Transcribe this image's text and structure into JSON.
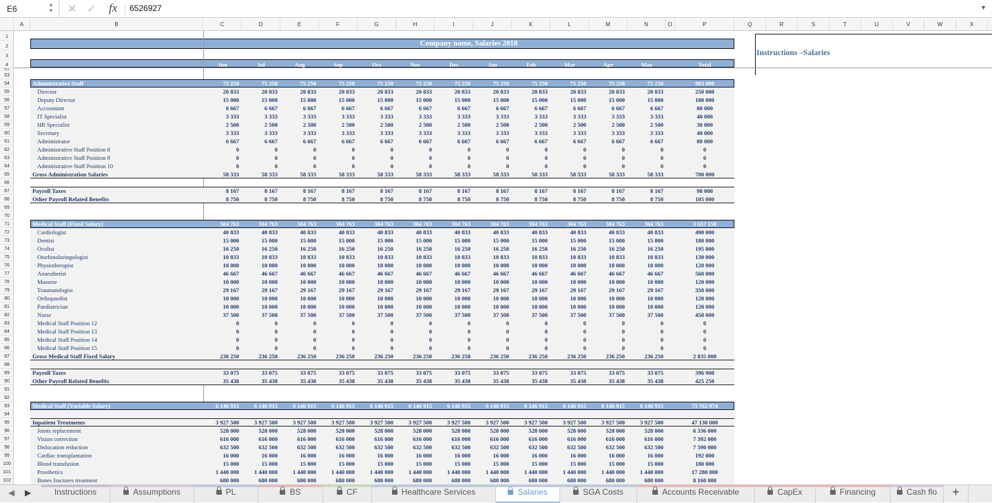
{
  "formula_bar": {
    "cell_ref": "E6",
    "fx_label": "fx",
    "value": "6526927"
  },
  "columns": [
    "A",
    "B",
    "C",
    "D",
    "E",
    "F",
    "G",
    "H",
    "I",
    "J",
    "K",
    "L",
    "M",
    "N",
    "O",
    "P",
    "Q",
    "R",
    "S",
    "T",
    "U",
    "V",
    "W",
    "X"
  ],
  "header": {
    "title": "Company name, Salaries 2018",
    "months": [
      "Jun",
      "Jul",
      "Aug",
      "Sep",
      "Oct",
      "Nov",
      "Dec",
      "Jan",
      "Feb",
      "Mar",
      "Apr",
      "May"
    ],
    "total_label": "Total",
    "instructions_title": "Instructions –Salaries"
  },
  "rows": [
    {
      "n": "52",
      "kind": "blank"
    },
    {
      "n": "53",
      "kind": "blank"
    },
    {
      "n": "54",
      "kind": "section",
      "label": "Administrative Staff",
      "monthly": "75 250",
      "total": "903 000"
    },
    {
      "n": "55",
      "kind": "item",
      "label": "Director",
      "monthly": "20 833",
      "total": "250 000"
    },
    {
      "n": "56",
      "kind": "item",
      "label": "Deputy Director",
      "monthly": "15 000",
      "total": "180 000"
    },
    {
      "n": "57",
      "kind": "item",
      "label": "Accountant",
      "monthly": "6 667",
      "total": "80 000"
    },
    {
      "n": "58",
      "kind": "item",
      "label": "IT Specialist",
      "monthly": "3 333",
      "total": "40 000"
    },
    {
      "n": "59",
      "kind": "item",
      "label": "HR Specialist",
      "monthly": "2 500",
      "total": "30 000"
    },
    {
      "n": "60",
      "kind": "item",
      "label": "Secretary",
      "monthly": "3 333",
      "total": "40 000"
    },
    {
      "n": "61",
      "kind": "item",
      "label": "Administrator",
      "monthly": "6 667",
      "total": "80 000"
    },
    {
      "n": "62",
      "kind": "item",
      "label": "Administrative Staff Position 8",
      "monthly": "0",
      "total": "0"
    },
    {
      "n": "63",
      "kind": "item",
      "label": "Administrative Staff Position 9",
      "monthly": "0",
      "total": "0"
    },
    {
      "n": "64",
      "kind": "item",
      "label": "Administrative Staff Position 10",
      "monthly": "0",
      "total": "0"
    },
    {
      "n": "65",
      "kind": "subtotal",
      "label": "Gross Administration Salaries",
      "monthly": "58 333",
      "total": "700 000"
    },
    {
      "n": "66",
      "kind": "blank"
    },
    {
      "n": "67",
      "kind": "bold",
      "label": "Payroll Taxes",
      "monthly": "8 167",
      "total": "98 000"
    },
    {
      "n": "68",
      "kind": "boldlast",
      "label": "Other Payroll Related Benefits",
      "monthly": "8 750",
      "total": "105 000"
    },
    {
      "n": "69",
      "kind": "blank"
    },
    {
      "n": "70",
      "kind": "blank"
    },
    {
      "n": "71",
      "kind": "section",
      "label": "Medical Staff (Fixed Salary)",
      "monthly": "304 763",
      "total": "3 657 150"
    },
    {
      "n": "72",
      "kind": "item",
      "label": "Cardiologist",
      "monthly": "40 833",
      "total": "490 000"
    },
    {
      "n": "73",
      "kind": "item",
      "label": "Dentist",
      "monthly": "15 000",
      "total": "180 000"
    },
    {
      "n": "74",
      "kind": "item",
      "label": "Oculist",
      "monthly": "16 250",
      "total": "195 000"
    },
    {
      "n": "75",
      "kind": "item",
      "label": "Otorhinolaringologist",
      "monthly": "10 833",
      "total": "130 000"
    },
    {
      "n": "76",
      "kind": "item",
      "label": "Physiotherapist",
      "monthly": "10 000",
      "total": "120 000"
    },
    {
      "n": "77",
      "kind": "item",
      "label": "Anaesthetist",
      "monthly": "46 667",
      "total": "560 000"
    },
    {
      "n": "78",
      "kind": "item",
      "label": "Masseur",
      "monthly": "10 000",
      "total": "120 000"
    },
    {
      "n": "79",
      "kind": "item",
      "label": "Traumatologist",
      "monthly": "29 167",
      "total": "350 000"
    },
    {
      "n": "80",
      "kind": "item",
      "label": "Orthopaedist",
      "monthly": "10 000",
      "total": "120 000"
    },
    {
      "n": "81",
      "kind": "item",
      "label": "Paediatrician",
      "monthly": "10 000",
      "total": "120 000"
    },
    {
      "n": "82",
      "kind": "item",
      "label": "Nurse",
      "monthly": "37 500",
      "total": "450 000"
    },
    {
      "n": "83",
      "kind": "item",
      "label": "Medical Staff Position 12",
      "monthly": "0",
      "total": "0"
    },
    {
      "n": "84",
      "kind": "item",
      "label": "Medical Staff Position 13",
      "monthly": "0",
      "total": "0"
    },
    {
      "n": "85",
      "kind": "item",
      "label": "Medical Staff Position 14",
      "monthly": "0",
      "total": "0"
    },
    {
      "n": "86",
      "kind": "item",
      "label": "Medical Staff Position 15",
      "monthly": "0",
      "total": "0"
    },
    {
      "n": "87",
      "kind": "subtotal",
      "label": "Gross Medical Staff Fixed Salary",
      "monthly": "236 250",
      "total": "2 835 000"
    },
    {
      "n": "88",
      "kind": "blank"
    },
    {
      "n": "89",
      "kind": "bold",
      "label": "Payroll Taxes",
      "monthly": "33 075",
      "total": "396 900"
    },
    {
      "n": "90",
      "kind": "boldlast",
      "label": "Other Payroll Related Benefits",
      "monthly": "35 438",
      "total": "425 250"
    },
    {
      "n": "91",
      "kind": "blank"
    },
    {
      "n": "92",
      "kind": "blank"
    },
    {
      "n": "93",
      "kind": "section",
      "label": "Medical Staff (Variable Salary)",
      "monthly": "6 146 915",
      "total": "73 762 974"
    },
    {
      "n": "94",
      "kind": "blank"
    },
    {
      "n": "95",
      "kind": "subtotal",
      "label": "Inpatient Treatments",
      "monthly": "3 927 500",
      "total": "47 130 000"
    },
    {
      "n": "96",
      "kind": "item",
      "label": "Joints replacement",
      "monthly": "528 000",
      "total": "6 336 000"
    },
    {
      "n": "97",
      "kind": "item",
      "label": "Vision correction",
      "monthly": "616 000",
      "total": "7 392 000"
    },
    {
      "n": "98",
      "kind": "item",
      "label": "Dislocation reduction",
      "monthly": "632 500",
      "total": "7 590 000"
    },
    {
      "n": "99",
      "kind": "item",
      "label": "Cardiac transplantation",
      "monthly": "16 000",
      "total": "192 000"
    },
    {
      "n": "100",
      "kind": "item",
      "label": "Blood transfusion",
      "monthly": "15 000",
      "total": "180 000"
    },
    {
      "n": "101",
      "kind": "item",
      "label": "Prosthetics",
      "monthly": "1 440 000",
      "total": "17 280 000"
    },
    {
      "n": "102",
      "kind": "item",
      "label": "Bones fractures treatment",
      "monthly": "680 000",
      "total": "8 160 000"
    }
  ],
  "tabs": [
    {
      "label": "Instructions",
      "locked": false,
      "color": "#cbbcd9"
    },
    {
      "label": "Assumptions",
      "locked": true,
      "color": "#d9c6e2"
    },
    {
      "label": "PL",
      "locked": true,
      "color": "#b9cce3"
    },
    {
      "label": "BS",
      "locked": true,
      "color": "#e8b8b8"
    },
    {
      "label": "CF",
      "locked": true,
      "color": "#c8e0b6"
    },
    {
      "label": "Healthcare Services",
      "locked": true,
      "color": "#b9cce3"
    },
    {
      "label": "Salaries",
      "locked": true,
      "color": "#b9cce3",
      "active": true
    },
    {
      "label": "SGA Costs",
      "locked": true,
      "color": "#b9cce3"
    },
    {
      "label": "Accounts Receivable",
      "locked": true,
      "color": "#e8b8b8"
    },
    {
      "label": "CapEx",
      "locked": true,
      "color": "#e8b8b8"
    },
    {
      "label": "Financing",
      "locked": true,
      "color": "#e8b8b8"
    },
    {
      "label": "Cash flo",
      "locked": true,
      "color": "#d9c6e2"
    }
  ],
  "add_sheet_label": "+"
}
